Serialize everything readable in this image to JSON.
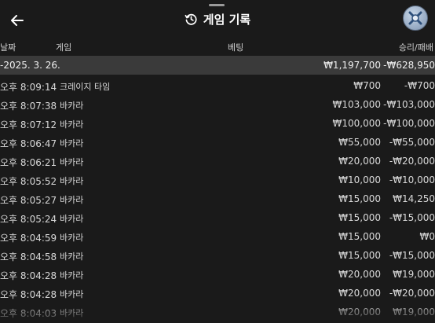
{
  "header": {
    "title": "게임 기록",
    "back_icon": "arrow-left-icon",
    "history_icon": "history-icon",
    "avatar_icon": "avatar-icon"
  },
  "columns": {
    "date": "날짜",
    "game": "게임",
    "bet": "베팅",
    "result": "승리/패배"
  },
  "date_group": {
    "label": "-2025. 3. 26.",
    "total_bet": "₩1,197,700",
    "total_result": "-₩628,950"
  },
  "rows": [
    {
      "time": "오후 8:09:14",
      "game": "크레이지 타임",
      "bet": "₩700",
      "result": "-₩700"
    },
    {
      "time": "오후 8:07:38",
      "game": "바카라",
      "bet": "₩103,000",
      "result": "-₩103,000"
    },
    {
      "time": "오후 8:07:12",
      "game": "바카라",
      "bet": "₩100,000",
      "result": "-₩100,000"
    },
    {
      "time": "오후 8:06:47",
      "game": "바카라",
      "bet": "₩55,000",
      "result": "-₩55,000"
    },
    {
      "time": "오후 8:06:21",
      "game": "바카라",
      "bet": "₩20,000",
      "result": "-₩20,000"
    },
    {
      "time": "오후 8:05:52",
      "game": "바카라",
      "bet": "₩10,000",
      "result": "-₩10,000"
    },
    {
      "time": "오후 8:05:27",
      "game": "바카라",
      "bet": "₩15,000",
      "result": "₩14,250"
    },
    {
      "time": "오후 8:05:24",
      "game": "바카라",
      "bet": "₩15,000",
      "result": "-₩15,000"
    },
    {
      "time": "오후 8:04:59",
      "game": "바카라",
      "bet": "₩15,000",
      "result": "₩0"
    },
    {
      "time": "오후 8:04:58",
      "game": "바카라",
      "bet": "₩15,000",
      "result": "-₩15,000"
    },
    {
      "time": "오후 8:04:28",
      "game": "바카라",
      "bet": "₩20,000",
      "result": "₩19,000"
    },
    {
      "time": "오후 8:04:28",
      "game": "바카라",
      "bet": "₩20,000",
      "result": "-₩20,000"
    },
    {
      "time": "오후 8:04:03",
      "game": "바카라",
      "bet": "₩20,000",
      "result": "₩19,000"
    }
  ]
}
